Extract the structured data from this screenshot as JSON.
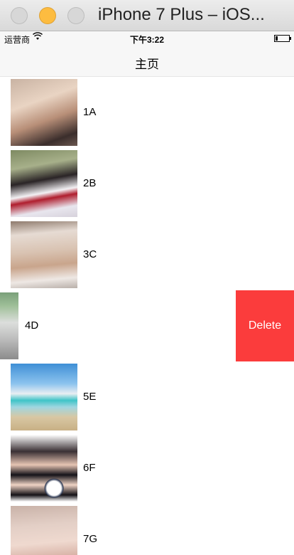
{
  "window": {
    "title": "iPhone 7 Plus – iOS..."
  },
  "statusbar": {
    "carrier": "运营商",
    "time": "下午3:22"
  },
  "navbar": {
    "title": "主页"
  },
  "rows": [
    {
      "label": "1A"
    },
    {
      "label": "2B"
    },
    {
      "label": "3C"
    },
    {
      "label": "4D",
      "delete_label": "Delete"
    },
    {
      "label": "5E"
    },
    {
      "label": "6F"
    },
    {
      "label": "7G"
    }
  ],
  "colors": {
    "delete": "#fb3c3c",
    "nav_bg": "#f7f7f7"
  }
}
